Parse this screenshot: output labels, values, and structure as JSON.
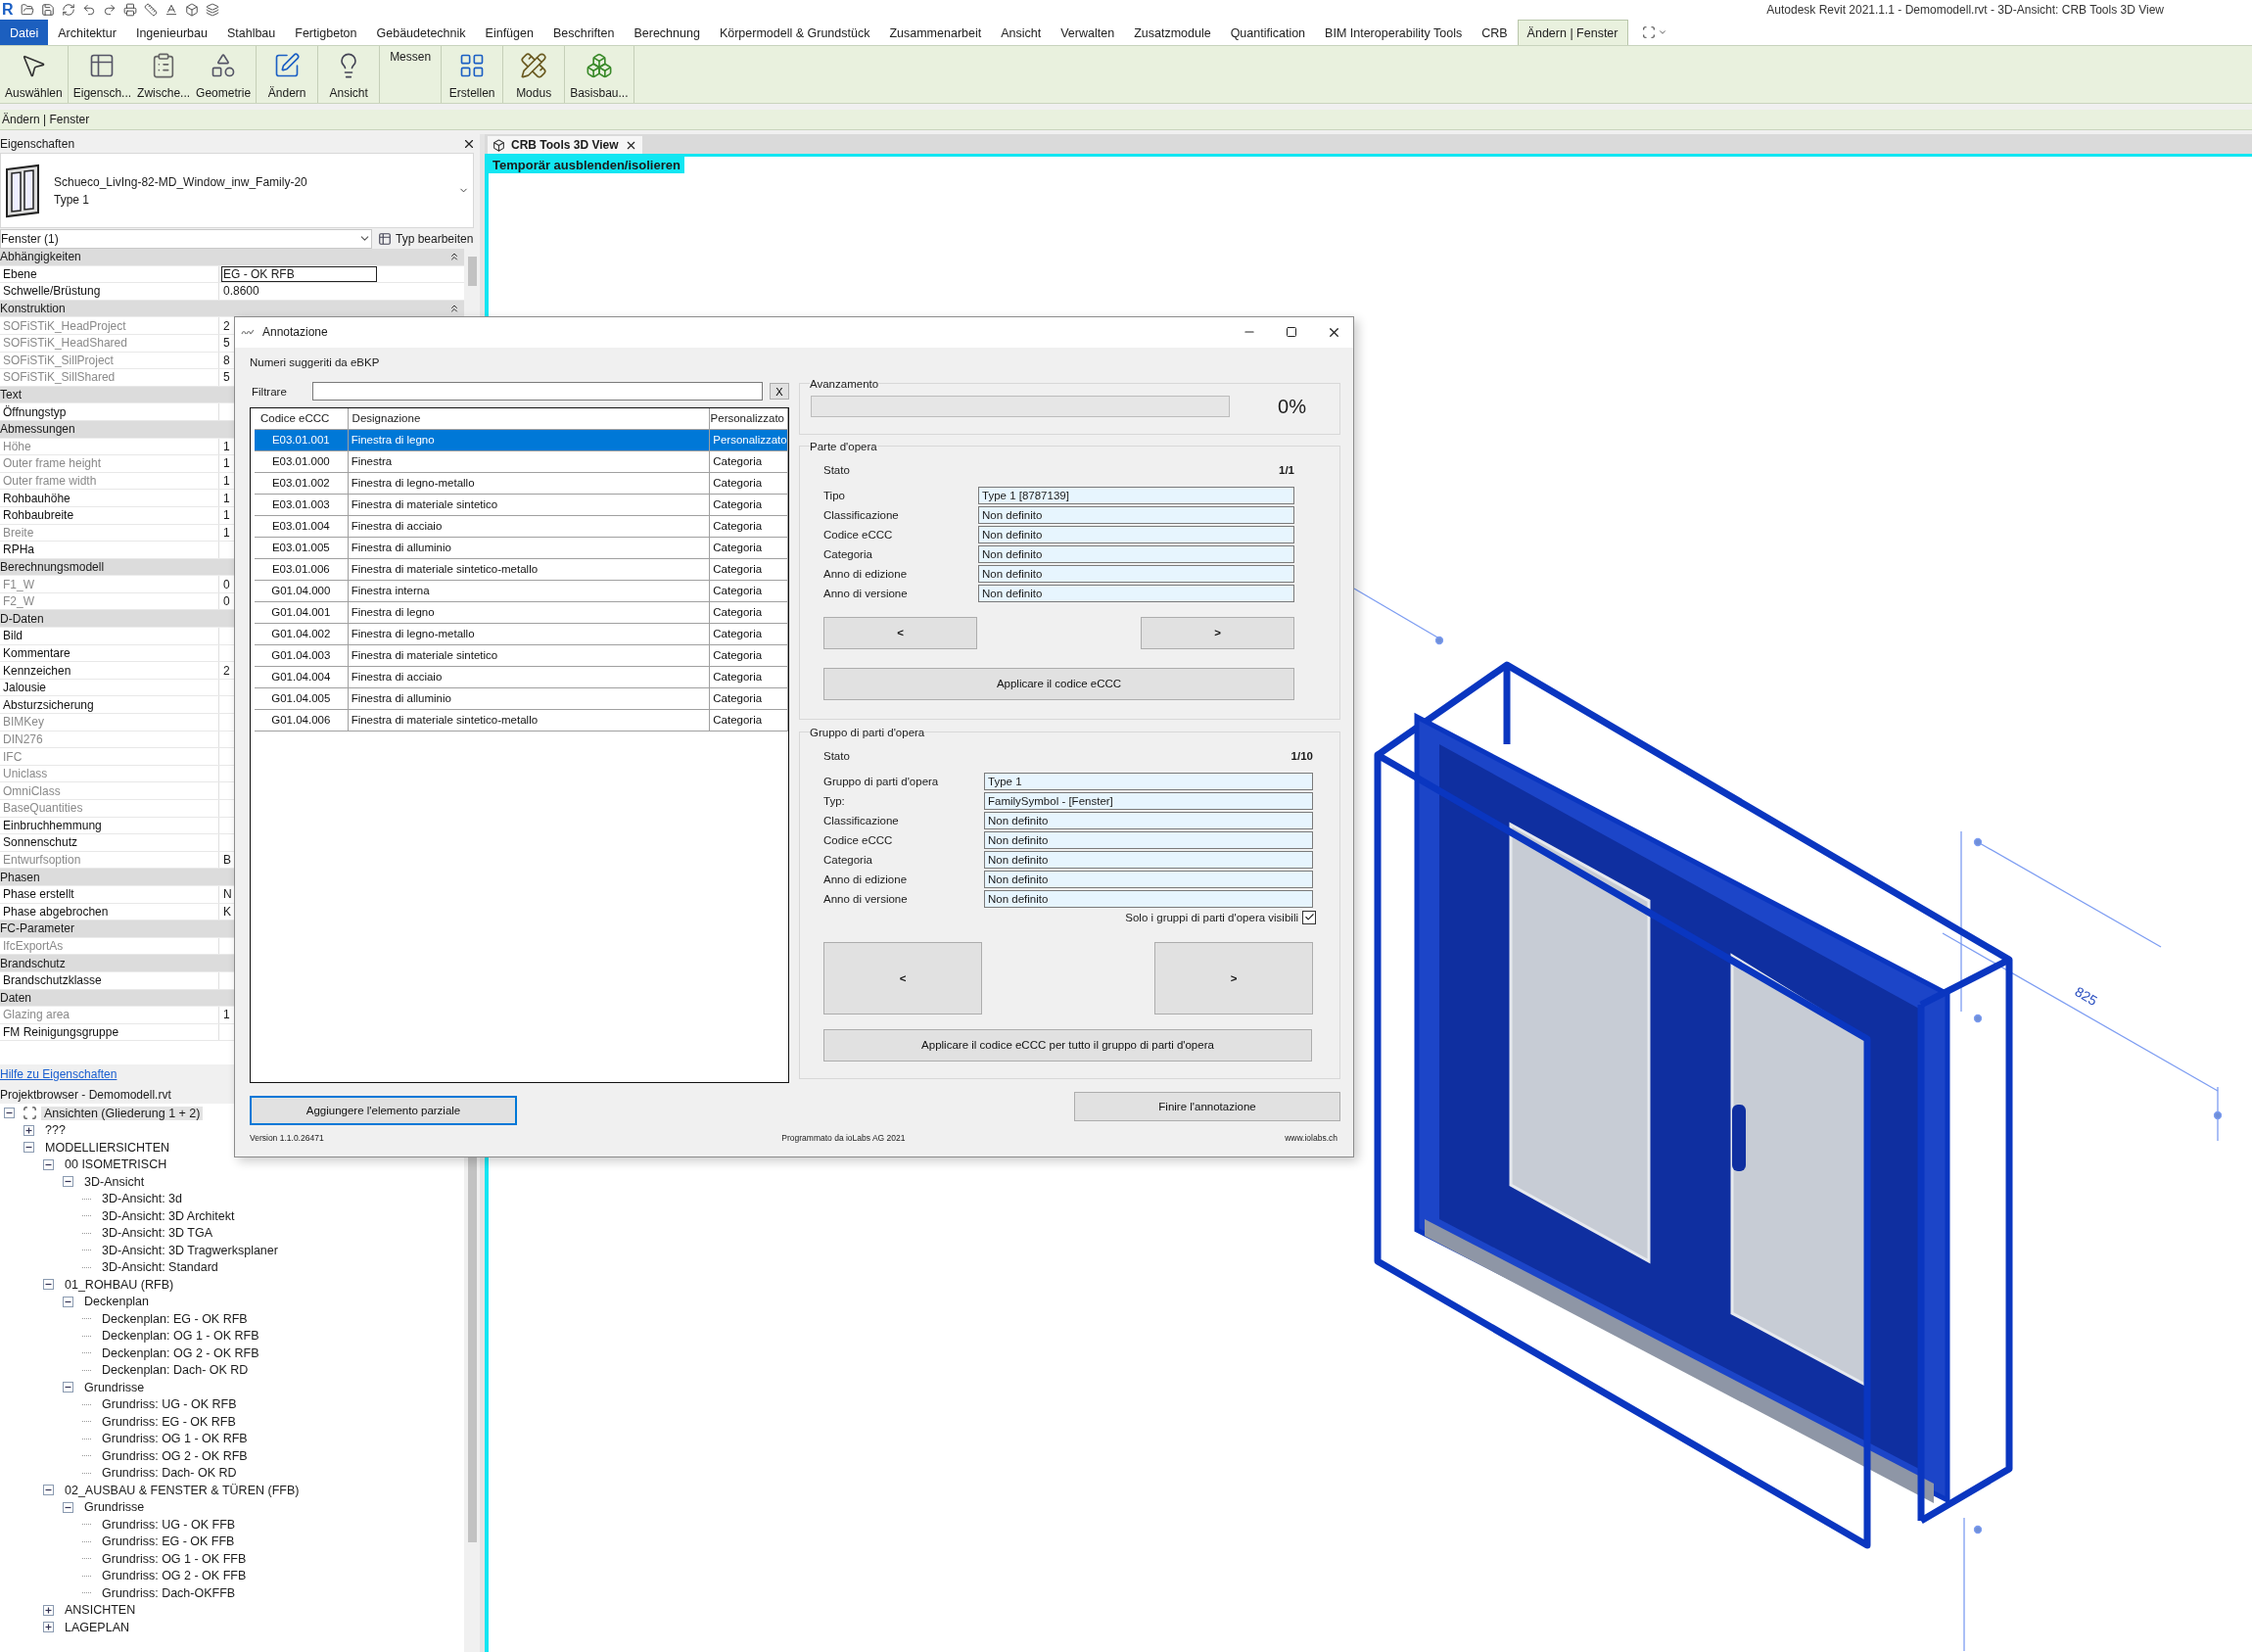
{
  "app": {
    "logo": "R",
    "title": "Autodesk Revit 2021.1.1 - Demomodell.rvt - 3D-Ansicht: CRB Tools 3D View"
  },
  "ribbon": {
    "tabs": [
      {
        "label": "Datei",
        "kind": "file",
        "selected": false
      },
      {
        "label": "Architektur",
        "kind": "tab",
        "selected": false
      },
      {
        "label": "Ingenieurbau",
        "kind": "tab",
        "selected": false
      },
      {
        "label": "Stahlbau",
        "kind": "tab",
        "selected": false
      },
      {
        "label": "Fertigbeton",
        "kind": "tab",
        "selected": false
      },
      {
        "label": "Gebäudetechnik",
        "kind": "tab",
        "selected": false
      },
      {
        "label": "Einfügen",
        "kind": "tab",
        "selected": false
      },
      {
        "label": "Beschriften",
        "kind": "tab",
        "selected": false
      },
      {
        "label": "Berechnung",
        "kind": "tab",
        "selected": false
      },
      {
        "label": "Körpermodell & Grundstück",
        "kind": "tab",
        "selected": false
      },
      {
        "label": "Zusammenarbeit",
        "kind": "tab",
        "selected": false
      },
      {
        "label": "Ansicht",
        "kind": "tab",
        "selected": false
      },
      {
        "label": "Verwalten",
        "kind": "tab",
        "selected": false
      },
      {
        "label": "Zusatzmodule",
        "kind": "tab",
        "selected": false
      },
      {
        "label": "Quantification",
        "kind": "tab",
        "selected": false
      },
      {
        "label": "BIM Interoperability Tools",
        "kind": "tab",
        "selected": false
      },
      {
        "label": "CRB",
        "kind": "tab",
        "selected": false
      },
      {
        "label": "Ändern | Fenster",
        "kind": "tab",
        "selected": true
      }
    ],
    "panels": [
      [
        {
          "label": "Auswählen",
          "kind": "pointer"
        }
      ],
      [
        {
          "label": "Eigensch...",
          "kind": "properties"
        },
        {
          "label": "Zwische...",
          "kind": "clipboard"
        },
        {
          "label": "Geometrie",
          "kind": "geometry"
        }
      ],
      [
        {
          "label": "Ändern",
          "kind": "modify"
        }
      ],
      [
        {
          "label": "Ansicht",
          "kind": "view"
        }
      ],
      [
        {
          "label": "Messen",
          "kind": "text"
        }
      ],
      [
        {
          "label": "Erstellen",
          "kind": "create"
        }
      ],
      [
        {
          "label": "Modus",
          "kind": "mode"
        }
      ],
      [
        {
          "label": "Basisbau...",
          "kind": "host"
        }
      ]
    ]
  },
  "context_bar": "Ändern | Fenster",
  "properties": {
    "title": "Eigenschaften",
    "type_name": "Schueco_LivIng-82-MD_Window_inw_Family-20",
    "type_sub": "Type 1",
    "instance_filter": "Fenster (1)",
    "edit_type": "Typ bearbeiten",
    "rows": [
      {
        "kind": "group",
        "label": "Abhängigkeiten",
        "expanded": true
      },
      {
        "kind": "param",
        "label": "Ebene",
        "disabled": false,
        "value": "EG - OK RFB",
        "active": true
      },
      {
        "kind": "param",
        "label": "Schwelle/Brüstung",
        "disabled": false,
        "value": "0.8600",
        "active": false
      },
      {
        "kind": "group",
        "label": "Konstruktion",
        "expanded": true
      },
      {
        "kind": "param",
        "label": "SOFiSTiK_HeadProject",
        "disabled": true,
        "value": "2"
      },
      {
        "kind": "param",
        "label": "SOFiSTiK_HeadShared",
        "disabled": true,
        "value": "5"
      },
      {
        "kind": "param",
        "label": "SOFiSTiK_SillProject",
        "disabled": true,
        "value": "8"
      },
      {
        "kind": "param",
        "label": "SOFiSTiK_SillShared",
        "disabled": true,
        "value": "5"
      },
      {
        "kind": "group",
        "label": "Text"
      },
      {
        "kind": "param",
        "label": "Öffnungstyp",
        "disabled": false
      },
      {
        "kind": "group",
        "label": "Abmessungen"
      },
      {
        "kind": "param",
        "label": "Höhe",
        "disabled": true,
        "value": "1"
      },
      {
        "kind": "param",
        "label": "Outer frame height",
        "disabled": true,
        "value": "1"
      },
      {
        "kind": "param",
        "label": "Outer frame width",
        "disabled": true,
        "value": "1"
      },
      {
        "kind": "param",
        "label": "Rohbauhöhe",
        "disabled": false,
        "value": "1"
      },
      {
        "kind": "param",
        "label": "Rohbaubreite",
        "disabled": false,
        "value": "1"
      },
      {
        "kind": "param",
        "label": "Breite",
        "disabled": true,
        "value": "1"
      },
      {
        "kind": "param",
        "label": "RPHa",
        "disabled": false
      },
      {
        "kind": "group",
        "label": "Berechnungsmodell"
      },
      {
        "kind": "param",
        "label": "F1_W",
        "disabled": true,
        "value": "0"
      },
      {
        "kind": "param",
        "label": "F2_W",
        "disabled": true,
        "value": "0"
      },
      {
        "kind": "group",
        "label": "D-Daten"
      },
      {
        "kind": "param",
        "label": "Bild",
        "disabled": false
      },
      {
        "kind": "param",
        "label": "Kommentare",
        "disabled": false
      },
      {
        "kind": "param",
        "label": "Kennzeichen",
        "disabled": false,
        "value": "2"
      },
      {
        "kind": "param",
        "label": "Jalousie",
        "disabled": false
      },
      {
        "kind": "param",
        "label": "Absturzsicherung",
        "disabled": false
      },
      {
        "kind": "param",
        "label": "BIMKey",
        "disabled": true
      },
      {
        "kind": "param",
        "label": "DIN276",
        "disabled": true
      },
      {
        "kind": "param",
        "label": "IFC",
        "disabled": true
      },
      {
        "kind": "param",
        "label": "Uniclass",
        "disabled": true
      },
      {
        "kind": "param",
        "label": "OmniClass",
        "disabled": true
      },
      {
        "kind": "param",
        "label": "BaseQuantities",
        "disabled": true
      },
      {
        "kind": "param",
        "label": "Einbruchhemmung",
        "disabled": false
      },
      {
        "kind": "param",
        "label": "Sonnenschutz",
        "disabled": false
      },
      {
        "kind": "param",
        "label": "Entwurfsoption",
        "disabled": true,
        "value": "B"
      },
      {
        "kind": "group",
        "label": "Phasen"
      },
      {
        "kind": "param",
        "label": "Phase erstellt",
        "disabled": false,
        "value": "N"
      },
      {
        "kind": "param",
        "label": "Phase abgebrochen",
        "disabled": false,
        "value": "K"
      },
      {
        "kind": "group",
        "label": "FC-Parameter"
      },
      {
        "kind": "param",
        "label": "IfcExportAs",
        "disabled": true
      },
      {
        "kind": "group",
        "label": "Brandschutz"
      },
      {
        "kind": "param",
        "label": "Brandschutzklasse",
        "disabled": false
      },
      {
        "kind": "group",
        "label": "Daten"
      },
      {
        "kind": "param",
        "label": "Glazing area",
        "disabled": true,
        "value": "1"
      },
      {
        "kind": "param",
        "label": "FM Reinigungsgruppe",
        "disabled": false
      }
    ],
    "help_link": "Hilfe zu Eigenschaften"
  },
  "project_browser": {
    "title": "Projektbrowser - Demomodell.rvt",
    "tree": [
      {
        "label": "Ansichten (Gliederung 1 + 2)",
        "expanded": true,
        "selected": true,
        "children": [
          {
            "label": "???",
            "expanded": false,
            "selected": false
          },
          {
            "label": "MODELLIERSICHTEN",
            "expanded": true,
            "selected": false,
            "children": [
              {
                "label": "00 ISOMETRISCH",
                "expanded": true,
                "selected": false,
                "children": [
                  {
                    "label": "3D-Ansicht",
                    "expanded": true,
                    "selected": false,
                    "children": [
                      {
                        "label": "3D-Ansicht: 3d",
                        "selected": false
                      },
                      {
                        "label": "3D-Ansicht: 3D Architekt",
                        "selected": false
                      },
                      {
                        "label": "3D-Ansicht: 3D TGA",
                        "selected": false
                      },
                      {
                        "label": "3D-Ansicht: 3D Tragwerksplaner",
                        "selected": false
                      },
                      {
                        "label": "3D-Ansicht: Standard",
                        "selected": false
                      }
                    ]
                  }
                ]
              },
              {
                "label": "01_ROHBAU (RFB)",
                "expanded": true,
                "selected": false,
                "children": [
                  {
                    "label": "Deckenplan",
                    "expanded": true,
                    "selected": false,
                    "children": [
                      {
                        "label": "Deckenplan: EG - OK RFB",
                        "selected": false
                      },
                      {
                        "label": "Deckenplan: OG 1 - OK RFB",
                        "selected": false
                      },
                      {
                        "label": "Deckenplan: OG 2 - OK RFB",
                        "selected": false
                      },
                      {
                        "label": "Deckenplan: Dach- OK RD",
                        "selected": false
                      }
                    ]
                  },
                  {
                    "label": "Grundrisse",
                    "expanded": true,
                    "selected": false,
                    "children": [
                      {
                        "label": "Grundriss: UG - OK RFB",
                        "selected": false
                      },
                      {
                        "label": "Grundriss: EG - OK RFB",
                        "selected": false
                      },
                      {
                        "label": "Grundriss: OG 1 - OK RFB",
                        "selected": false
                      },
                      {
                        "label": "Grundriss: OG 2 - OK RFB",
                        "selected": false
                      },
                      {
                        "label": "Grundriss: Dach- OK RD",
                        "selected": false
                      }
                    ]
                  }
                ]
              },
              {
                "label": "02_AUSBAU & FENSTER & TÜREN (FFB)",
                "expanded": true,
                "selected": false,
                "children": [
                  {
                    "label": "Grundrisse",
                    "expanded": true,
                    "selected": false,
                    "children": [
                      {
                        "label": "Grundriss: UG - OK FFB",
                        "selected": false
                      },
                      {
                        "label": "Grundriss: EG - OK FFB",
                        "selected": false
                      },
                      {
                        "label": "Grundriss: OG 1 - OK FFB",
                        "selected": false
                      },
                      {
                        "label": "Grundriss: OG 2 - OK FFB",
                        "selected": false
                      },
                      {
                        "label": "Grundriss: Dach-OKFFB",
                        "selected": false
                      }
                    ]
                  }
                ]
              },
              {
                "label": "ANSICHTEN",
                "expanded": false,
                "selected": false
              },
              {
                "label": "LAGEPLAN",
                "expanded": false,
                "selected": false
              }
            ]
          }
        ]
      }
    ]
  },
  "view": {
    "tab": "CRB Tools 3D View",
    "banner": "Temporär ausblenden/isolieren",
    "dimension_label": "825"
  },
  "dialog": {
    "title": "Annotazione",
    "suggestions_label": "Numeri suggeriti da eBKP",
    "filter_label": "Filtrare",
    "filter_clear": "X",
    "columns": [
      "Codice eCCC",
      "Designazione",
      "Personalizzato"
    ],
    "rows": [
      {
        "code": "E03.01.001",
        "designation": "Finestra di legno",
        "type": "Personalizzato",
        "selected": true
      },
      {
        "code": "E03.01.000",
        "designation": "Finestra",
        "type": "Categoria",
        "selected": false
      },
      {
        "code": "E03.01.002",
        "designation": "Finestra di legno-metallo",
        "type": "Categoria",
        "selected": false
      },
      {
        "code": "E03.01.003",
        "designation": "Finestra di materiale sintetico",
        "type": "Categoria",
        "selected": false
      },
      {
        "code": "E03.01.004",
        "designation": "Finestra di acciaio",
        "type": "Categoria",
        "selected": false
      },
      {
        "code": "E03.01.005",
        "designation": "Finestra di alluminio",
        "type": "Categoria",
        "selected": false
      },
      {
        "code": "E03.01.006",
        "designation": "Finestra di materiale sintetico-metallo",
        "type": "Categoria",
        "selected": false
      },
      {
        "code": "G01.04.000",
        "designation": "Finestra interna",
        "type": "Categoria",
        "selected": false
      },
      {
        "code": "G01.04.001",
        "designation": "Finestra di legno",
        "type": "Categoria",
        "selected": false
      },
      {
        "code": "G01.04.002",
        "designation": "Finestra di legno-metallo",
        "type": "Categoria",
        "selected": false
      },
      {
        "code": "G01.04.003",
        "designation": "Finestra di materiale sintetico",
        "type": "Categoria",
        "selected": false
      },
      {
        "code": "G01.04.004",
        "designation": "Finestra di acciaio",
        "type": "Categoria",
        "selected": false
      },
      {
        "code": "G01.04.005",
        "designation": "Finestra di alluminio",
        "type": "Categoria",
        "selected": false
      },
      {
        "code": "G01.04.006",
        "designation": "Finestra di materiale sintetico-metallo",
        "type": "Categoria",
        "selected": false
      }
    ],
    "add_button": {
      "label": "Aggiungere l'elemento parziale",
      "focused": true
    },
    "progress": {
      "label": "Avanzamento",
      "level": 0,
      "reading": "0%"
    },
    "part": {
      "title": "Parte d'opera",
      "status_label": "Stato",
      "status": "1/1",
      "fields": [
        {
          "label": "Tipo",
          "value": "Type 1 [8787139]"
        },
        {
          "label": "Classificazione",
          "value": "Non definito"
        },
        {
          "label": "Codice eCCC",
          "value": "Non definito"
        },
        {
          "label": "Categoria",
          "value": "Non definito"
        },
        {
          "label": "Anno di edizione",
          "value": "Non definito"
        },
        {
          "label": "Anno di versione",
          "value": "Non definito"
        }
      ],
      "prev": "<",
      "next": ">",
      "apply": "Applicare il codice eCCC"
    },
    "group": {
      "title": "Gruppo di parti d'opera",
      "status_label": "Stato",
      "status": "1/10",
      "fields": [
        {
          "label": "Gruppo di parti d'opera",
          "value": "Type 1"
        },
        {
          "label": "Typ:",
          "value": "FamilySymbol - [Fenster]"
        },
        {
          "label": "Classificazione",
          "value": "Non definito"
        },
        {
          "label": "Codice eCCC",
          "value": "Non definito"
        },
        {
          "label": "Categoria",
          "value": "Non definito"
        },
        {
          "label": "Anno di edizione",
          "value": "Non definito"
        },
        {
          "label": "Anno di versione",
          "value": "Non definito"
        }
      ],
      "visible_only": {
        "label": "Solo i gruppi di parti d'opera visibili",
        "checked": true
      },
      "prev": "<",
      "next": ">",
      "apply": "Applicare il codice eCCC per tutto il gruppo di parti d'opera"
    },
    "finish": "Finire l'annotazione",
    "version": "Version 1.1.0.26471",
    "credit": "Programmato da ioLabs AG 2021",
    "website": "www.iolabs.ch"
  }
}
